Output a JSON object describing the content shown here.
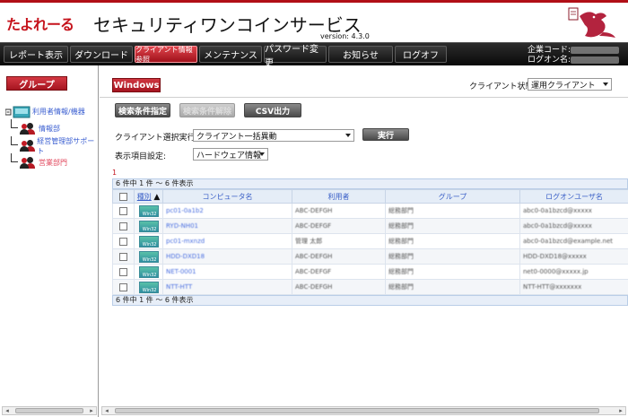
{
  "header": {
    "logo_text": "たよれーる",
    "service_title": "セキュリティワンコインサービス",
    "version": "version: 4.3.0"
  },
  "nav": {
    "items": [
      {
        "label": "レポート表示",
        "active": false
      },
      {
        "label": "ダウンロード",
        "active": false
      },
      {
        "label": "クライアント情報参照",
        "active": true
      },
      {
        "label": "メンテナンス",
        "active": false
      },
      {
        "label": "パスワード変更",
        "active": false
      },
      {
        "label": "お知らせ",
        "active": false
      },
      {
        "label": "ログオフ",
        "active": false
      }
    ],
    "company_code_label": "企業コード:",
    "company_code_value": "●●●●●●●●",
    "logon_name_label": "ログオン名:",
    "logon_name_value": "●●●●●●●●"
  },
  "sidebar": {
    "group_button": "グループ",
    "tree": {
      "root_label": "利用者情報/機器",
      "children": [
        {
          "label": "情報部",
          "color": "blue"
        },
        {
          "label": "経営管理部サポート",
          "color": "blue"
        },
        {
          "label": "営業部門",
          "color": "red"
        }
      ]
    }
  },
  "main": {
    "tab_label": "Windows",
    "client_state_label": "クライアント状態:",
    "client_state_value": "運用クライアント",
    "buttons": {
      "search_condition": "検索条件指定",
      "clear_condition": "検索条件解除",
      "csv_export": "CSV出力",
      "execute": "実行"
    },
    "bulk_action_label": "クライアント選択実行:",
    "bulk_action_value": "クライアント一括異動",
    "display_label": "表示項目設定:",
    "display_value": "ハードウェア情報",
    "page_indicator": "1",
    "count_top": "6 件中 1 件 〜 6 件表示",
    "count_bottom": "6 件中 1 件 〜 6 件表示",
    "columns": [
      "種別",
      "コンピュータ名",
      "利用者",
      "グループ",
      "ログオンユーザ名"
    ],
    "type_label": "Win32",
    "rows": [
      {
        "computer": "pc01-0a1b2",
        "user": "ABC-DEFGH",
        "group": "総務部門",
        "logon": "abc0-0a1bzcd@xxxxx"
      },
      {
        "computer": "RYD-NH01",
        "user": "ABC-DEFGF",
        "group": "総務部門",
        "logon": "abc0-0a1bzcd@xxxxx"
      },
      {
        "computer": "pc01-mxnzd",
        "user": "管理 太郎",
        "group": "総務部門",
        "logon": "abc0-0a1bzcd@example.net"
      },
      {
        "computer": "HDD-DXD18",
        "user": "ABC-DEFGH",
        "group": "総務部門",
        "logon": "HDD-DXD18@xxxxx"
      },
      {
        "computer": "NET-0001",
        "user": "ABC-DEFGF",
        "group": "総務部門",
        "logon": "net0-0000@xxxxx.jp"
      },
      {
        "computer": "NTT-HTT",
        "user": "ABC-DEFGH",
        "group": "総務部門",
        "logon": "NTT-HTT@xxxxxxx"
      }
    ]
  },
  "colors": {
    "brand_red": "#c41a24",
    "nav_dark": "#111111",
    "link_blue": "#3a5fc7"
  }
}
